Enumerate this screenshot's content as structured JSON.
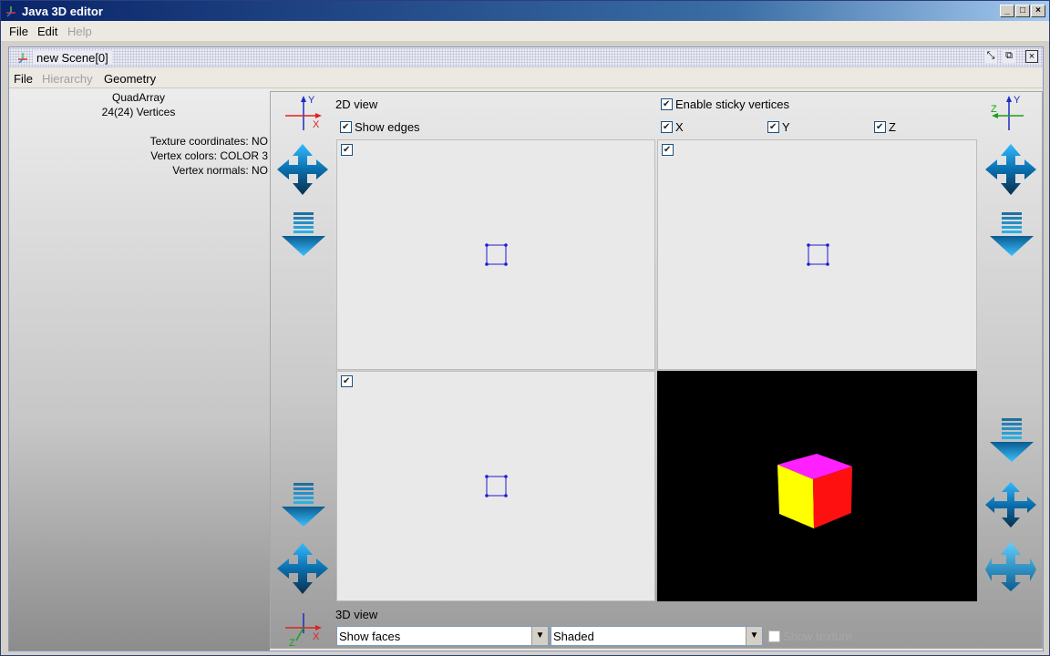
{
  "window": {
    "title": "Java 3D editor"
  },
  "menubar": {
    "file": "File",
    "edit": "Edit",
    "help": "Help"
  },
  "scene": {
    "title": "new Scene[0]",
    "menu": {
      "file": "File",
      "hierarchy": "Hierarchy",
      "geometry": "Geometry"
    }
  },
  "info": {
    "geometry_type": "QuadArray",
    "vertices": "24(24) Vertices",
    "texture_coordinates": "Texture coordinates: NO",
    "vertex_colors": "Vertex colors: COLOR 3",
    "vertex_normals": "Vertex normals: NO"
  },
  "editor": {
    "view2d_label": "2D view",
    "view3d_label": "3D view",
    "show_edges": {
      "label": "Show edges",
      "checked": true
    },
    "sticky_vertices": {
      "label": "Enable sticky vertices",
      "checked": true
    },
    "axes": {
      "x": "X",
      "y": "Y",
      "z": "Z"
    },
    "axis_letters": {
      "x": "X",
      "y": "Y",
      "z": "Z"
    },
    "face_mode": {
      "value": "Show faces"
    },
    "shading_mode": {
      "value": "Shaded"
    },
    "show_texture": {
      "label": "Show texture",
      "checked": false
    }
  },
  "colors": {
    "vertex_blue": "#1b1bd6",
    "cube_top": "#ff20ff",
    "cube_left": "#ffff00",
    "cube_right": "#ff1010"
  }
}
